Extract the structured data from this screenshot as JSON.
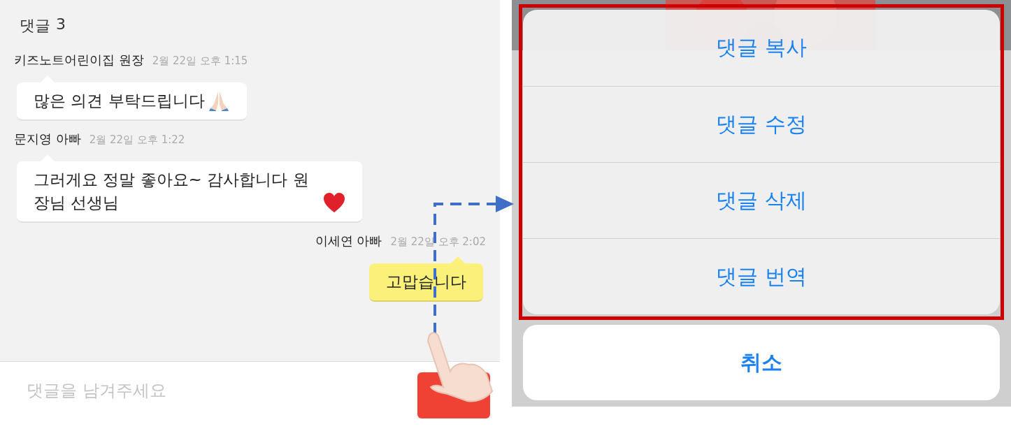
{
  "comments_panel": {
    "title": "댓글",
    "count": "3",
    "comments": [
      {
        "author": "키즈노트어린이집 원장",
        "time": "2월 22일 오후 1:15",
        "text": "많은 의견 부탁드립니다",
        "kind": "pray",
        "mine": false
      },
      {
        "author": "문지영 아빠",
        "time": "2월 22일 오후 1:22",
        "text": "그러게요 정말 좋아요~ 감사합니다 원장님 선생님",
        "kind": "heart",
        "mine": false
      },
      {
        "author": "이세연 아빠",
        "time": "2월 22일 오후 2:02",
        "text": "고맙습니다",
        "kind": "plain",
        "mine": true
      }
    ],
    "input": {
      "placeholder": "댓글을 남겨주세요"
    }
  },
  "action_sheet": {
    "highlighted": true,
    "actions": [
      "댓글 복사",
      "댓글 수정",
      "댓글 삭제",
      "댓글 번역"
    ],
    "cancel": "취소"
  }
}
